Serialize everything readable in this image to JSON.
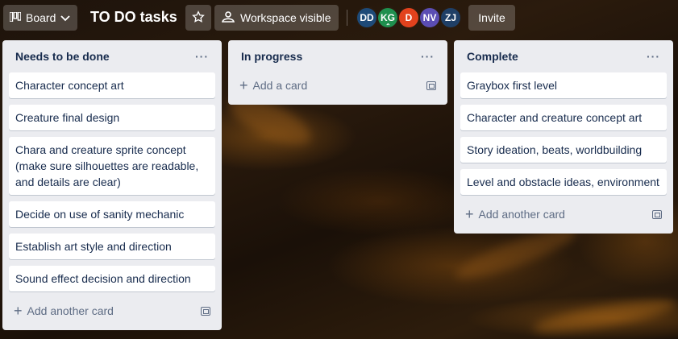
{
  "header": {
    "view_label": "Board",
    "board_title": "TO DO tasks",
    "visibility_label": "Workspace visible",
    "invite_label": "Invite",
    "members": [
      {
        "initials": "DD",
        "color": "#1e4a78"
      },
      {
        "initials": "KG",
        "color": "#1f8f4e"
      },
      {
        "initials": "D",
        "color": "#e2421d"
      },
      {
        "initials": "NV",
        "color": "#5b4db3"
      },
      {
        "initials": "ZJ",
        "color": "#1f3f66"
      }
    ]
  },
  "lists": [
    {
      "title": "Needs to be done",
      "menu": "···",
      "cards": [
        "Character concept art",
        "Creature final design",
        "Chara and creature sprite concept (make sure silhouettes are readable, and details are clear)",
        "Decide on use of sanity mechanic",
        "Establish art style and direction",
        "Sound effect decision and direction"
      ],
      "add_label": "Add another card"
    },
    {
      "title": "In progress",
      "menu": "···",
      "cards": [],
      "add_label": "Add a card"
    },
    {
      "title": "Complete",
      "menu": "···",
      "cards": [
        "Graybox first level",
        "Character and creature concept art",
        "Story ideation, beats, worldbuilding",
        "Level and obstacle ideas, environment"
      ],
      "add_label": "Add another card"
    }
  ]
}
